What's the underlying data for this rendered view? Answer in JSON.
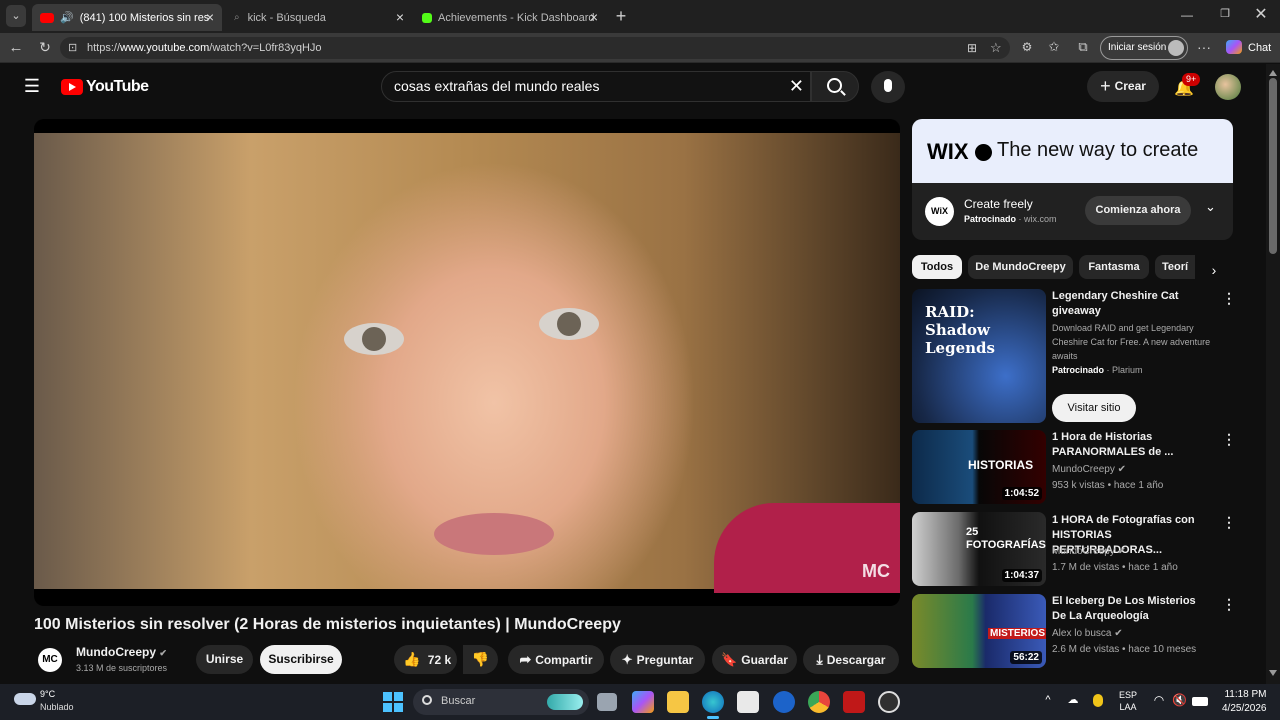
{
  "browser": {
    "tabs": [
      {
        "title": "(841) 100 Misterios sin resolv",
        "active": true
      },
      {
        "title": "kick - Búsqueda",
        "active": false
      },
      {
        "title": "Achievements - Kick Dashboard",
        "active": false
      }
    ],
    "url_prefix": "https://",
    "url_host": "www.youtube.com",
    "url_path": "/watch?v=L0fr83yqHJo",
    "signin_label": "Iniciar sesión",
    "chat_label": "Chat"
  },
  "youtube": {
    "logo_text": "YouTube",
    "search_value": "cosas extrañas del mundo reales",
    "create_label": "Crear",
    "notif_badge": "9+",
    "video": {
      "title": "100 Misterios sin resolver (2 Horas de misterios inquietantes) | MundoCreepy",
      "channel": "MundoCreepy",
      "subscribers": "3.13 M de suscriptores",
      "join_label": "Unirse",
      "subscribe_label": "Suscribirse",
      "likes": "72 k",
      "share_label": "Compartir",
      "ask_label": "Preguntar",
      "save_label": "Guardar",
      "download_label": "Descargar"
    },
    "ad": {
      "banner_brand": "WIX",
      "banner_text": "The new way to create",
      "title": "Create freely",
      "sponsored": "Patrocinado",
      "domain": "wix.com",
      "cta": "Comienza ahora",
      "logo": "WiX"
    },
    "chips": [
      "Todos",
      "De MundoCreepy",
      "Fantasma",
      "Teorí"
    ],
    "sponsored_card": {
      "title": "Legendary Cheshire Cat giveaway",
      "desc": "Download RAID and get Legendary Cheshire Cat for Free. A new adventure awaits",
      "sponsored": "Patrocinado",
      "advertiser": "Plarium",
      "cta": "Visitar sitio",
      "thumb_text": "RAID: Shadow Legends"
    },
    "related": [
      {
        "title": "1 Hora de Historias PARANORMALES de ...",
        "channel": "MundoCreepy",
        "stats": "953 k vistas • hace 1 año",
        "duration": "1:04:52",
        "thumb_text": "HISTORIAS",
        "verified": true
      },
      {
        "title": "1 HORA de Fotografías con HISTORIAS PERTURBADORAS...",
        "channel": "MundoCreepy",
        "stats": "1.7 M de vistas • hace 1 año",
        "duration": "1:04:37",
        "thumb_text": "25 FOTOGRAFÍAS",
        "verified": true
      },
      {
        "title": "El Iceberg De Los Misterios De La Arqueología",
        "channel": "Alex lo busca",
        "stats": "2.6 M de vistas • hace 10 meses",
        "duration": "56:22",
        "thumb_text": "MISTERIOS",
        "verified": true
      }
    ]
  },
  "taskbar": {
    "weather_temp": "9°C",
    "weather_desc": "Nublado",
    "search_placeholder": "Buscar",
    "lang1": "ESP",
    "lang2": "LAA",
    "time": "11:18 PM",
    "date": "4/25/2026"
  }
}
